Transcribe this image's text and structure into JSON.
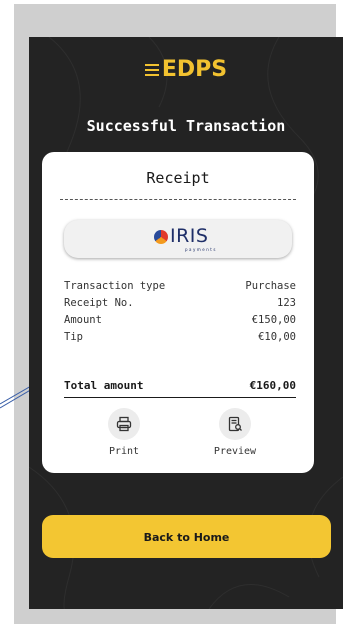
{
  "app": {
    "logo_text": "EDPS"
  },
  "page": {
    "title": "Successful Transaction"
  },
  "receipt": {
    "title": "Receipt",
    "brand": {
      "name": "IRIS",
      "subtitle": "payments"
    },
    "rows": [
      {
        "label": "Transaction type",
        "value": "Purchase"
      },
      {
        "label": "Receipt No.",
        "value": "123"
      },
      {
        "label": "Amount",
        "value": "€150,00"
      },
      {
        "label": "Tip",
        "value": "€10,00"
      }
    ],
    "total": {
      "label": "Total amount",
      "value": "€160,00"
    },
    "actions": [
      {
        "label": "Print",
        "icon": "printer-icon"
      },
      {
        "label": "Preview",
        "icon": "document-preview-icon"
      }
    ]
  },
  "footer": {
    "home_button_label": "Back to Home"
  },
  "colors": {
    "accent": "#f3c632",
    "background": "#232323",
    "card": "#ffffff"
  }
}
